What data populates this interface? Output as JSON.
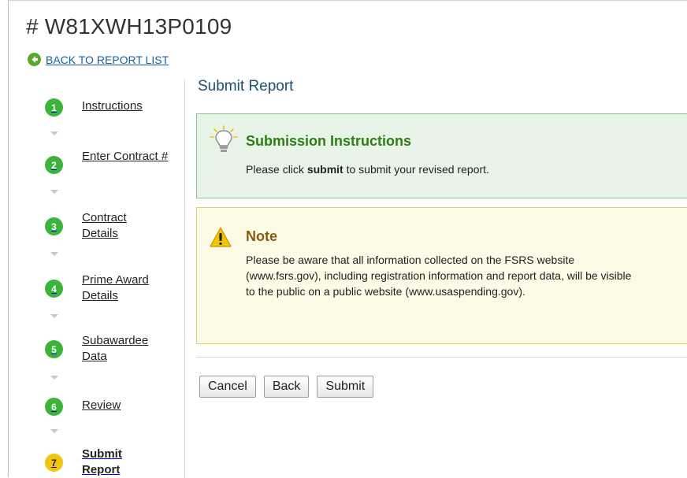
{
  "header": {
    "title": "# W81XWH13P0109",
    "back_link": "BACK TO REPORT LIST"
  },
  "steps": [
    {
      "number": "1",
      "label": "Instructions"
    },
    {
      "number": "2",
      "label": "Enter Contract #"
    },
    {
      "number": "3",
      "label": "Contract Details"
    },
    {
      "number": "4",
      "label": "Prime Award Details"
    },
    {
      "number": "5",
      "label": "Subawardee Data"
    },
    {
      "number": "6",
      "label": "Review"
    },
    {
      "number": "7",
      "label": "Submit Report"
    }
  ],
  "main": {
    "title": "Submit Report",
    "instructions": {
      "heading": "Submission Instructions",
      "text_before": "Please click ",
      "text_bold": "submit",
      "text_after": " to submit your revised report."
    },
    "note": {
      "heading": "Note",
      "text": "Please be aware that all information collected on the FSRS website (www.fsrs.gov), including registration information and report data, will be visible to the public on a public website (www.usaspending.gov)."
    },
    "buttons": {
      "cancel": "Cancel",
      "back": "Back",
      "submit": "Submit"
    }
  },
  "colors": {
    "step_done": "#3cb43c",
    "step_current": "#f1c40f",
    "link": "#1a5fa3"
  }
}
